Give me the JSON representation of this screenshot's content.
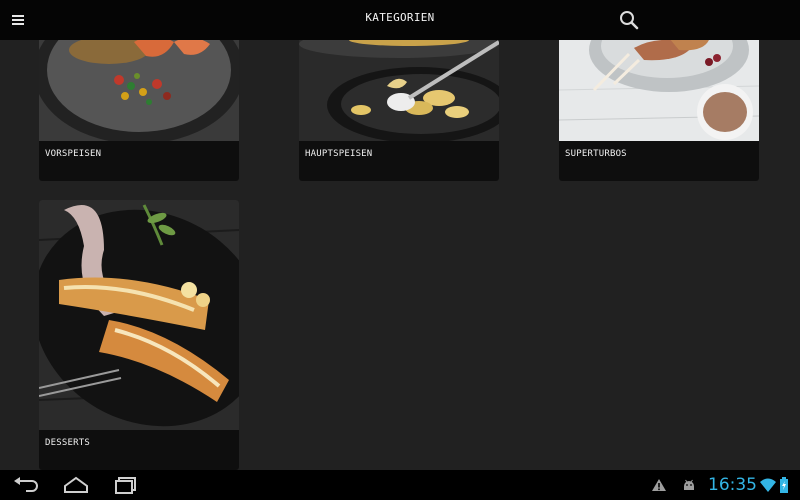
{
  "header": {
    "title": "KATEGORIEN",
    "menu_icon": "hamburger-menu-icon",
    "search_icon": "search-icon"
  },
  "categories": [
    {
      "label": "VORSPEISEN"
    },
    {
      "label": "HAUPTSPEISEN"
    },
    {
      "label": "SUPERTURBOS"
    },
    {
      "label": "DESSERTS"
    }
  ],
  "navbar": {
    "back_icon": "back-icon",
    "home_icon": "home-icon",
    "recents_icon": "recent-apps-icon",
    "warning_icon": "warning-icon",
    "android_icon": "android-debug-icon",
    "wifi_icon": "wifi-icon",
    "battery_icon": "battery-charging-icon",
    "clock": "16:35"
  },
  "colors": {
    "clock": "#33b5e5",
    "background": "#212121",
    "bar": "#050505"
  }
}
